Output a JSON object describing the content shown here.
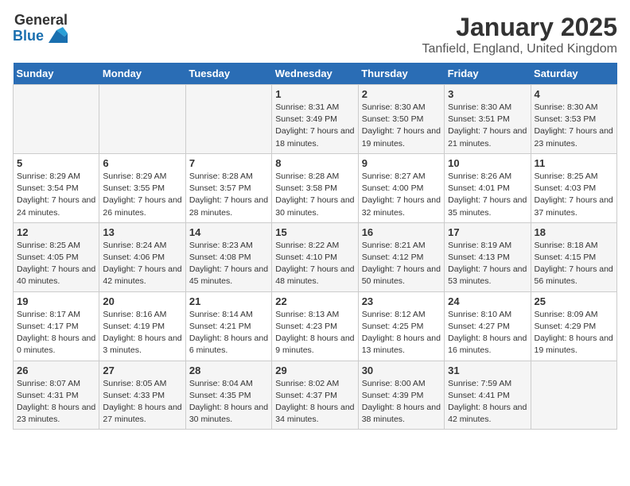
{
  "logo": {
    "general": "General",
    "blue": "Blue"
  },
  "title": "January 2025",
  "subtitle": "Tanfield, England, United Kingdom",
  "days_header": [
    "Sunday",
    "Monday",
    "Tuesday",
    "Wednesday",
    "Thursday",
    "Friday",
    "Saturday"
  ],
  "weeks": [
    [
      {
        "day": "",
        "sunrise": "",
        "sunset": "",
        "daylight": ""
      },
      {
        "day": "",
        "sunrise": "",
        "sunset": "",
        "daylight": ""
      },
      {
        "day": "",
        "sunrise": "",
        "sunset": "",
        "daylight": ""
      },
      {
        "day": "1",
        "sunrise": "Sunrise: 8:31 AM",
        "sunset": "Sunset: 3:49 PM",
        "daylight": "Daylight: 7 hours and 18 minutes."
      },
      {
        "day": "2",
        "sunrise": "Sunrise: 8:30 AM",
        "sunset": "Sunset: 3:50 PM",
        "daylight": "Daylight: 7 hours and 19 minutes."
      },
      {
        "day": "3",
        "sunrise": "Sunrise: 8:30 AM",
        "sunset": "Sunset: 3:51 PM",
        "daylight": "Daylight: 7 hours and 21 minutes."
      },
      {
        "day": "4",
        "sunrise": "Sunrise: 8:30 AM",
        "sunset": "Sunset: 3:53 PM",
        "daylight": "Daylight: 7 hours and 23 minutes."
      }
    ],
    [
      {
        "day": "5",
        "sunrise": "Sunrise: 8:29 AM",
        "sunset": "Sunset: 3:54 PM",
        "daylight": "Daylight: 7 hours and 24 minutes."
      },
      {
        "day": "6",
        "sunrise": "Sunrise: 8:29 AM",
        "sunset": "Sunset: 3:55 PM",
        "daylight": "Daylight: 7 hours and 26 minutes."
      },
      {
        "day": "7",
        "sunrise": "Sunrise: 8:28 AM",
        "sunset": "Sunset: 3:57 PM",
        "daylight": "Daylight: 7 hours and 28 minutes."
      },
      {
        "day": "8",
        "sunrise": "Sunrise: 8:28 AM",
        "sunset": "Sunset: 3:58 PM",
        "daylight": "Daylight: 7 hours and 30 minutes."
      },
      {
        "day": "9",
        "sunrise": "Sunrise: 8:27 AM",
        "sunset": "Sunset: 4:00 PM",
        "daylight": "Daylight: 7 hours and 32 minutes."
      },
      {
        "day": "10",
        "sunrise": "Sunrise: 8:26 AM",
        "sunset": "Sunset: 4:01 PM",
        "daylight": "Daylight: 7 hours and 35 minutes."
      },
      {
        "day": "11",
        "sunrise": "Sunrise: 8:25 AM",
        "sunset": "Sunset: 4:03 PM",
        "daylight": "Daylight: 7 hours and 37 minutes."
      }
    ],
    [
      {
        "day": "12",
        "sunrise": "Sunrise: 8:25 AM",
        "sunset": "Sunset: 4:05 PM",
        "daylight": "Daylight: 7 hours and 40 minutes."
      },
      {
        "day": "13",
        "sunrise": "Sunrise: 8:24 AM",
        "sunset": "Sunset: 4:06 PM",
        "daylight": "Daylight: 7 hours and 42 minutes."
      },
      {
        "day": "14",
        "sunrise": "Sunrise: 8:23 AM",
        "sunset": "Sunset: 4:08 PM",
        "daylight": "Daylight: 7 hours and 45 minutes."
      },
      {
        "day": "15",
        "sunrise": "Sunrise: 8:22 AM",
        "sunset": "Sunset: 4:10 PM",
        "daylight": "Daylight: 7 hours and 48 minutes."
      },
      {
        "day": "16",
        "sunrise": "Sunrise: 8:21 AM",
        "sunset": "Sunset: 4:12 PM",
        "daylight": "Daylight: 7 hours and 50 minutes."
      },
      {
        "day": "17",
        "sunrise": "Sunrise: 8:19 AM",
        "sunset": "Sunset: 4:13 PM",
        "daylight": "Daylight: 7 hours and 53 minutes."
      },
      {
        "day": "18",
        "sunrise": "Sunrise: 8:18 AM",
        "sunset": "Sunset: 4:15 PM",
        "daylight": "Daylight: 7 hours and 56 minutes."
      }
    ],
    [
      {
        "day": "19",
        "sunrise": "Sunrise: 8:17 AM",
        "sunset": "Sunset: 4:17 PM",
        "daylight": "Daylight: 8 hours and 0 minutes."
      },
      {
        "day": "20",
        "sunrise": "Sunrise: 8:16 AM",
        "sunset": "Sunset: 4:19 PM",
        "daylight": "Daylight: 8 hours and 3 minutes."
      },
      {
        "day": "21",
        "sunrise": "Sunrise: 8:14 AM",
        "sunset": "Sunset: 4:21 PM",
        "daylight": "Daylight: 8 hours and 6 minutes."
      },
      {
        "day": "22",
        "sunrise": "Sunrise: 8:13 AM",
        "sunset": "Sunset: 4:23 PM",
        "daylight": "Daylight: 8 hours and 9 minutes."
      },
      {
        "day": "23",
        "sunrise": "Sunrise: 8:12 AM",
        "sunset": "Sunset: 4:25 PM",
        "daylight": "Daylight: 8 hours and 13 minutes."
      },
      {
        "day": "24",
        "sunrise": "Sunrise: 8:10 AM",
        "sunset": "Sunset: 4:27 PM",
        "daylight": "Daylight: 8 hours and 16 minutes."
      },
      {
        "day": "25",
        "sunrise": "Sunrise: 8:09 AM",
        "sunset": "Sunset: 4:29 PM",
        "daylight": "Daylight: 8 hours and 19 minutes."
      }
    ],
    [
      {
        "day": "26",
        "sunrise": "Sunrise: 8:07 AM",
        "sunset": "Sunset: 4:31 PM",
        "daylight": "Daylight: 8 hours and 23 minutes."
      },
      {
        "day": "27",
        "sunrise": "Sunrise: 8:05 AM",
        "sunset": "Sunset: 4:33 PM",
        "daylight": "Daylight: 8 hours and 27 minutes."
      },
      {
        "day": "28",
        "sunrise": "Sunrise: 8:04 AM",
        "sunset": "Sunset: 4:35 PM",
        "daylight": "Daylight: 8 hours and 30 minutes."
      },
      {
        "day": "29",
        "sunrise": "Sunrise: 8:02 AM",
        "sunset": "Sunset: 4:37 PM",
        "daylight": "Daylight: 8 hours and 34 minutes."
      },
      {
        "day": "30",
        "sunrise": "Sunrise: 8:00 AM",
        "sunset": "Sunset: 4:39 PM",
        "daylight": "Daylight: 8 hours and 38 minutes."
      },
      {
        "day": "31",
        "sunrise": "Sunrise: 7:59 AM",
        "sunset": "Sunset: 4:41 PM",
        "daylight": "Daylight: 8 hours and 42 minutes."
      },
      {
        "day": "",
        "sunrise": "",
        "sunset": "",
        "daylight": ""
      }
    ]
  ]
}
